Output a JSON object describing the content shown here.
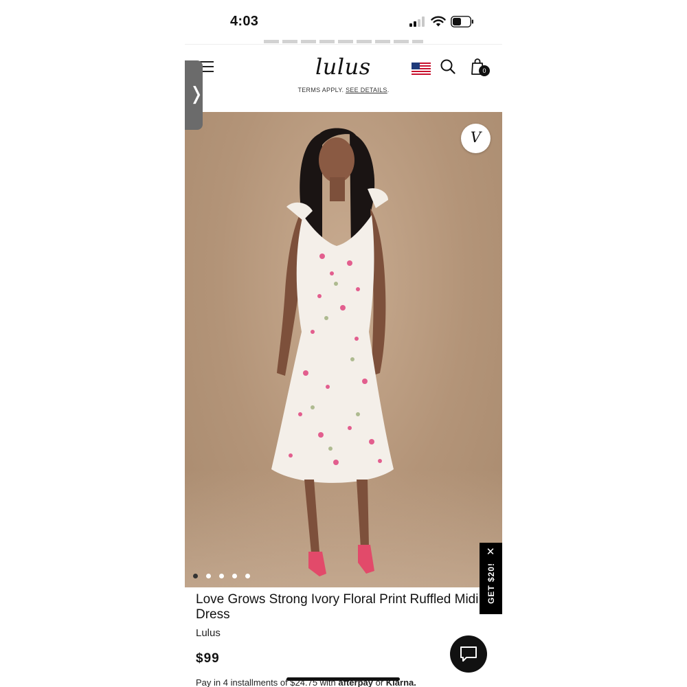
{
  "status_bar": {
    "time": "4:03"
  },
  "header": {
    "logo": "lulus",
    "bag_count": "0",
    "icons": [
      "menu-icon",
      "flag-icon",
      "search-icon",
      "shopping-bag-icon"
    ]
  },
  "promo": {
    "terms_prefix": "TERMS APPLY.",
    "terms_link": "SEE DETAILS"
  },
  "side_tab": {
    "glyph": "❭"
  },
  "hero": {
    "favorite_glyph": "V",
    "carousel": {
      "total": 5,
      "active": 1
    }
  },
  "get_offer": {
    "label": "GET $20!",
    "close_glyph": "✕"
  },
  "product": {
    "title": "Love Grows Strong Ivory Floral Print Ruffled Midi Dress",
    "brand": "Lulus",
    "price": "$99",
    "installments_prefix": "Pay in 4 installments of $24.75 with",
    "afterpay": "afterpay",
    "or": "or",
    "klarna": "Klarna."
  },
  "colors": {
    "background_photo": "#b39478",
    "text": "#111111",
    "offer_tab": "#000000"
  }
}
